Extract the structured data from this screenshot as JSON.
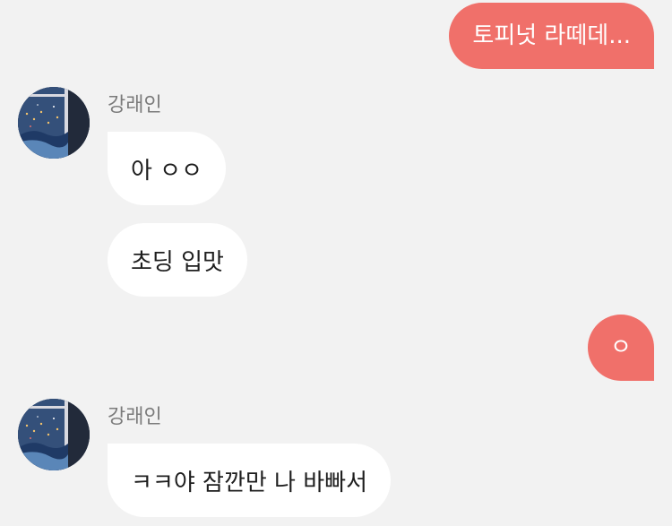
{
  "conversation": {
    "sender_name": "강래인",
    "messages": [
      {
        "direction": "outgoing",
        "text": "토피넛 라떼데..."
      },
      {
        "direction": "incoming",
        "sender": "강래인",
        "text": "아 ㅇㅇ"
      },
      {
        "direction": "incoming",
        "sender": "강래인",
        "text": "초딩 입맛"
      },
      {
        "direction": "outgoing",
        "text": "ㅇ"
      },
      {
        "direction": "incoming",
        "sender": "강래인",
        "text": "ㅋㅋ야 잠깐만 나 바빠서"
      }
    ]
  },
  "colors": {
    "background": "#f2f2f2",
    "outgoing_bubble": "#f0706a",
    "incoming_bubble": "#ffffff",
    "sender_name": "#7b7b7b"
  }
}
